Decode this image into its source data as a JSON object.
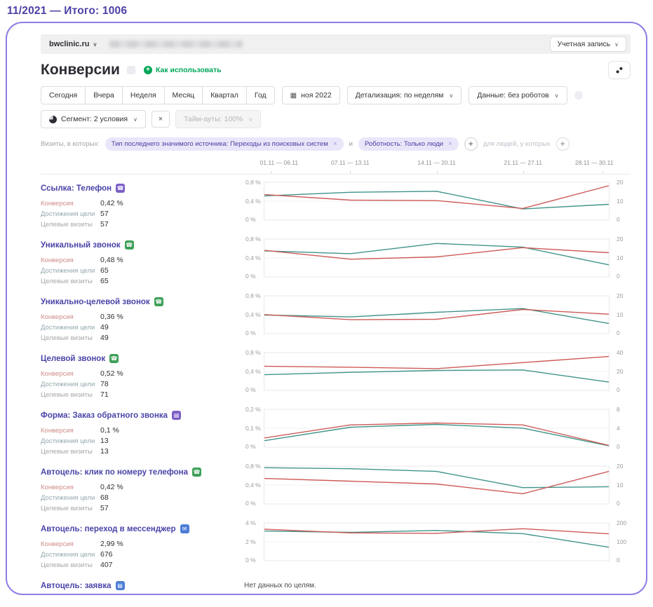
{
  "page": {
    "period_label": "11/2021 — Итого: 1006"
  },
  "topbar": {
    "site": "bwclinic.ru",
    "account": "Учетная запись"
  },
  "title": {
    "text": "Конверсии",
    "help": "Как использовать"
  },
  "icons": {
    "chevron": "∨",
    "calendar": "▦",
    "plus": "+",
    "close": "×"
  },
  "toolbar": {
    "period_tabs": [
      "Сегодня",
      "Вчера",
      "Неделя",
      "Месяц",
      "Квартал",
      "Год"
    ],
    "date_button": "ноя 2022",
    "detail_dropdown": "Детализация: по неделям",
    "data_dropdown": "Данные: без роботов",
    "segment_dropdown": "Сегмент: 2 условия",
    "timeouts_dropdown": "Тайм-ауты: 100%"
  },
  "filters": {
    "prefix": "Визиты, в которых:",
    "joiner": "и",
    "suffix": "для людей, у которых",
    "chips": [
      "Тип последнего значимого источника: Переходы из поисковых систем",
      "Роботность: Только люди"
    ]
  },
  "columns": [
    "01.11 — 06.11",
    "07.11 — 13.11",
    "14.11 — 20.11",
    "21.11 — 27.11",
    "28.11 — 30.11"
  ],
  "stat_labels": {
    "conversion": "Конверсия",
    "goals": "Достижения цели",
    "visits": "Целевые визиты"
  },
  "colors": {
    "line_conversion": "#cd5a57",
    "line_goals": "#3f948a",
    "accent_purple": "#4a41a4",
    "chip_bg": "#e9e6fa",
    "green_link": "#00a656"
  },
  "no_data_text": "Нет данных по целям.",
  "sections": [
    {
      "title": "Ссылка: Телефон",
      "icon": {
        "name": "phone-link-goal-icon",
        "glyph": "☎",
        "color": "#7d5fc6"
      },
      "conversion": "0,42 %",
      "goals": "57",
      "visits": "57",
      "chart": {
        "left_ticks": [
          "0,8 %",
          "0,4 %",
          "0 %"
        ],
        "right_ticks": [
          "20",
          "10",
          "0"
        ],
        "left_max": 0.8,
        "right_max": 20,
        "conversion_pct": [
          0.55,
          0.43,
          0.42,
          0.25,
          0.74
        ],
        "goal_counts": [
          13,
          15,
          15.5,
          6,
          8.5
        ]
      }
    },
    {
      "title": "Уникальный звонок",
      "icon": {
        "name": "unique-call-goal-icon",
        "glyph": "☎",
        "color": "#3fa05a"
      },
      "conversion": "0,48 %",
      "goals": "65",
      "visits": "65",
      "chart": {
        "left_ticks": [
          "0,8 %",
          "0,4 %",
          "0 %"
        ],
        "right_ticks": [
          "20",
          "10",
          "0"
        ],
        "left_max": 0.8,
        "right_max": 20,
        "conversion_pct": [
          0.57,
          0.38,
          0.43,
          0.63,
          0.52
        ],
        "goal_counts": [
          14,
          12.5,
          18,
          16,
          6.5
        ]
      }
    },
    {
      "title": "Уникально-целевой звонок",
      "icon": {
        "name": "unique-target-call-goal-icon",
        "glyph": "☎",
        "color": "#3fa05a"
      },
      "conversion": "0,36 %",
      "goals": "49",
      "visits": "49",
      "chart": {
        "left_ticks": [
          "0,8 %",
          "0,4 %",
          "0 %"
        ],
        "right_ticks": [
          "20",
          "10",
          "0"
        ],
        "left_max": 0.8,
        "right_max": 20,
        "conversion_pct": [
          0.41,
          0.3,
          0.31,
          0.52,
          0.42
        ],
        "goal_counts": [
          10,
          9,
          11.5,
          13.5,
          5.5
        ]
      }
    },
    {
      "title": "Целевой звонок",
      "icon": {
        "name": "target-call-goal-icon",
        "glyph": "☎",
        "color": "#3fa05a"
      },
      "conversion": "0,52 %",
      "goals": "78",
      "visits": "71",
      "chart": {
        "left_ticks": [
          "0,8 %",
          "0,4 %",
          "0 %"
        ],
        "right_ticks": [
          "40",
          "20",
          "0"
        ],
        "left_max": 0.8,
        "right_max": 40,
        "conversion_pct": [
          0.52,
          0.5,
          0.47,
          0.6,
          0.73
        ],
        "goal_counts": [
          17,
          19.5,
          21.5,
          22,
          9
        ]
      }
    },
    {
      "title": "Форма: Заказ обратного звонка",
      "icon": {
        "name": "callback-form-goal-icon",
        "glyph": "▤",
        "color": "#7d5fc6"
      },
      "conversion": "0,1 %",
      "goals": "13",
      "visits": "13",
      "chart": {
        "left_ticks": [
          "0,2 %",
          "0,1 %",
          "0 %"
        ],
        "right_ticks": [
          "8",
          "4",
          "0"
        ],
        "left_max": 0.2,
        "right_max": 8,
        "conversion_pct": [
          0.05,
          0.12,
          0.13,
          0.12,
          0.01
        ],
        "goal_counts": [
          1.4,
          4.3,
          4.9,
          4.1,
          0.3
        ]
      }
    },
    {
      "title": "Автоцель: клик по номеру телефона",
      "icon": {
        "name": "autogoal-phone-click-icon",
        "glyph": "☎",
        "color": "#3fa05a"
      },
      "conversion": "0,42 %",
      "goals": "68",
      "visits": "57",
      "chart": {
        "left_ticks": [
          "0,8 %",
          "0,4 %",
          "0 %"
        ],
        "right_ticks": [
          "20",
          "10",
          "0"
        ],
        "left_max": 0.8,
        "right_max": 20,
        "conversion_pct": [
          0.55,
          0.49,
          0.43,
          0.22,
          0.7
        ],
        "goal_counts": [
          19.5,
          19,
          17.5,
          8.8,
          9.3
        ]
      }
    },
    {
      "title": "Автоцель: переход в мессенджер",
      "icon": {
        "name": "autogoal-messenger-icon",
        "glyph": "✉",
        "color": "#4d7dd6"
      },
      "conversion": "2,99 %",
      "goals": "676",
      "visits": "407",
      "chart": {
        "left_ticks": [
          "4 %",
          "2 %",
          "0 %"
        ],
        "right_ticks": [
          "200",
          "100",
          "0"
        ],
        "left_max": 4,
        "right_max": 200,
        "conversion_pct": [
          3.4,
          3.0,
          2.95,
          3.45,
          2.9
        ],
        "goal_counts": [
          160,
          153,
          163,
          146,
          73
        ]
      }
    },
    {
      "title": "Автоцель: заявка",
      "icon": {
        "name": "autogoal-request-icon",
        "glyph": "▤",
        "color": "#4d7dd6"
      },
      "conversion": null,
      "goals": null,
      "visits": null,
      "chart": null
    }
  ]
}
